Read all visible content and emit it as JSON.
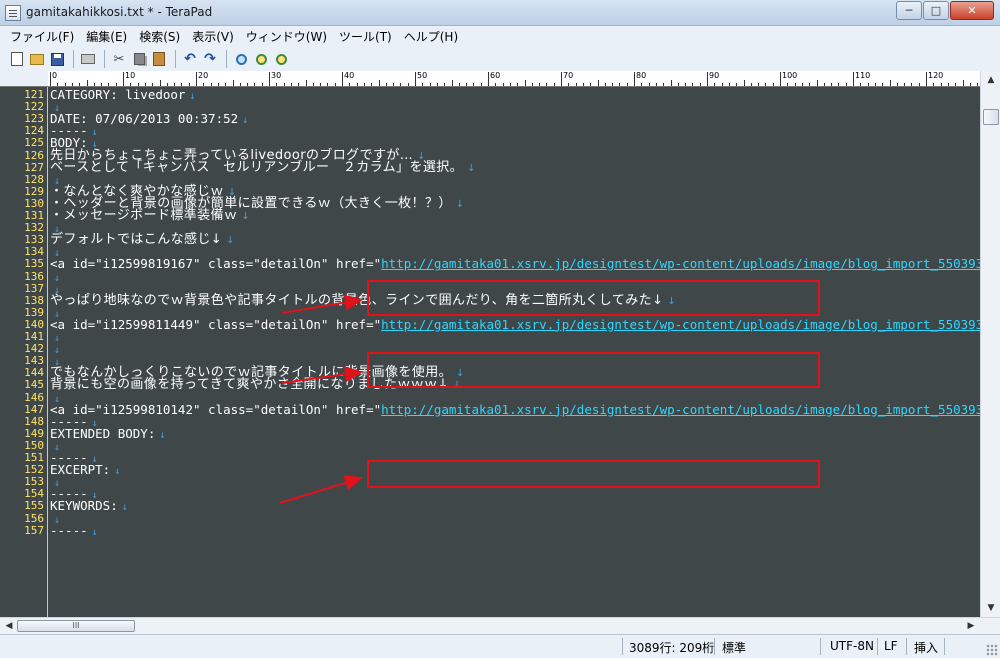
{
  "window": {
    "title": "gamitakahikkosi.txt * - TeraPad",
    "min_glyph": "─",
    "max_glyph": "□",
    "close_glyph": "✕"
  },
  "menu": [
    "ファイル(F)",
    "編集(E)",
    "検索(S)",
    "表示(V)",
    "ウィンドウ(W)",
    "ツール(T)",
    "ヘルプ(H)"
  ],
  "toolbar": {
    "icons": [
      "new-file-icon",
      "open-folder-icon",
      "save-icon",
      "print-icon",
      "cut-icon",
      "copy-icon",
      "paste-icon",
      "undo-icon",
      "redo-icon",
      "find-icon",
      "find-next-icon",
      "find-prev-icon"
    ],
    "cut_glyph": "✂",
    "undo_glyph": "↶",
    "redo_glyph": "↷"
  },
  "ruler": {
    "labels": [
      "0",
      "10",
      "20",
      "30",
      "40",
      "50",
      "60",
      "70",
      "80",
      "90",
      "100",
      "110",
      "120"
    ]
  },
  "editor": {
    "eol_mark": "↓",
    "lines": [
      {
        "n": "121",
        "text": "CATEGORY: livedoor"
      },
      {
        "n": "122",
        "text": ""
      },
      {
        "n": "123",
        "text": "DATE: 07/06/2013 00:37:52"
      },
      {
        "n": "124",
        "text": "-----"
      },
      {
        "n": "125",
        "text": "BODY:"
      },
      {
        "n": "126",
        "text": "先日からちょこちょこ弄っているlivedoorのブログですが…"
      },
      {
        "n": "127",
        "text": "ベースとして「キャンバス　セルリアンブルー　２カラム」を選択。"
      },
      {
        "n": "128",
        "text": ""
      },
      {
        "n": "129",
        "text": "・なんとなく爽やかな感じｗ"
      },
      {
        "n": "130",
        "text": "・ヘッダーと背景の画像が簡単に設置できるｗ（大きく一枚！？）"
      },
      {
        "n": "131",
        "text": "・メッセージボード標準装備ｗ"
      },
      {
        "n": "132",
        "text": ""
      },
      {
        "n": "133",
        "text": "デフォルトではこんな感じ↓"
      },
      {
        "n": "134",
        "text": ""
      },
      {
        "n": "135",
        "text": "<a id=\"i12599819167\" class=\"detailOn\" href=\"",
        "link": "http://gamitaka01.xsrv.jp/designtest/wp-content/uploads/image/blog_import_55039364e"
      },
      {
        "n": "136",
        "text": ""
      },
      {
        "n": "137",
        "text": ""
      },
      {
        "n": "138",
        "text": "やっぱり地味なのでｗ背景色や記事タイトルの背景色、ラインで囲んだり、角を二箇所丸くしてみた↓"
      },
      {
        "n": "139",
        "text": ""
      },
      {
        "n": "140",
        "text": "<a id=\"i12599811449\" class=\"detailOn\" href=\"",
        "link": "http://gamitaka01.xsrv.jp/designtest/wp-content/uploads/image/blog_import_55039366O"
      },
      {
        "n": "141",
        "text": ""
      },
      {
        "n": "142",
        "text": ""
      },
      {
        "n": "143",
        "text": ""
      },
      {
        "n": "144",
        "text": "でもなんかしっくりこないのでｗ記事タイトルに背景画像を使用。"
      },
      {
        "n": "145",
        "text": "背景にも空の画像を持ってきて爽やかさ全開になりましたｗｗｗ↓"
      },
      {
        "n": "146",
        "text": ""
      },
      {
        "n": "147",
        "text": "<a id=\"i12599810142\" class=\"detailOn\" href=\"",
        "link": "http://gamitaka01.xsrv.jp/designtest/wp-content/uploads/image/blog_import_55039366e"
      },
      {
        "n": "148",
        "text": "-----"
      },
      {
        "n": "149",
        "text": "EXTENDED BODY:"
      },
      {
        "n": "150",
        "text": ""
      },
      {
        "n": "151",
        "text": "-----"
      },
      {
        "n": "152",
        "text": "EXCERPT:"
      },
      {
        "n": "153",
        "text": ""
      },
      {
        "n": "154",
        "text": "-----"
      },
      {
        "n": "155",
        "text": "KEYWORDS:"
      },
      {
        "n": "156",
        "text": ""
      },
      {
        "n": "157",
        "text": "-----"
      }
    ]
  },
  "scrollbar": {
    "up_glyph": "▲",
    "down_glyph": "▼",
    "left_glyph": "◀",
    "right_glyph": "▶",
    "thumb_grip": "III"
  },
  "status": {
    "position": "3089行: 209桁",
    "mode": "標準",
    "encoding": "UTF-8N",
    "line_ending": "LF",
    "insert_mode": "挿入"
  },
  "annotation_color": "#e2111a",
  "link_color": "#2fd7ff",
  "editor_bg": "#3f4749",
  "linenum_color": "#ffe36b"
}
